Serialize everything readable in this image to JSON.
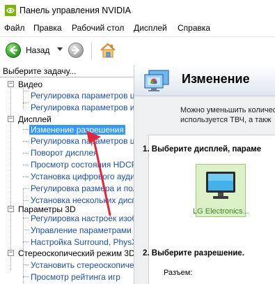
{
  "window": {
    "title": "Панель управления NVIDIA"
  },
  "menu": [
    "Файл",
    "Правка",
    "Рабочий стол",
    "Дисплей",
    "Справка"
  ],
  "toolbar": {
    "back_label": "Назад"
  },
  "left_pane": {
    "header": "Выберите задачу...",
    "tree": [
      {
        "label": "Видео",
        "expander": "−",
        "children": [
          "Регулировка параметров це",
          "Регулировка параметров из"
        ]
      },
      {
        "label": "Дисплей",
        "expander": "−",
        "children": [
          "Изменение разрешения",
          "Регулировка параметров це",
          "Поворот дисплея",
          "Просмотр состояния HDCP",
          "Установка цифрового аудио",
          "Регулировка размера и поло",
          "Установка нескольких дисп"
        ]
      },
      {
        "label": "Параметры 3D",
        "expander": "−",
        "children": [
          "Регулировка настроек изоб",
          "Управление параметрами 3D",
          "Настройка Surround, PhysX"
        ]
      },
      {
        "label": "Стереоскопический режим 3D",
        "expander": "−",
        "children": [
          "Установить стереоскопичес",
          "Просмотр рейтинга игр"
        ]
      }
    ],
    "selected": "Изменение разрешения"
  },
  "right_pane": {
    "banner_title": "Изменение",
    "desc_line1": "Можно уменьшить количес",
    "desc_line2": "используется ТВЧ, а такж",
    "step1": "1. Выберите дисплей, параме",
    "display_name": "LG Electronics...",
    "step2": "2. Выберите разрешение.",
    "connector_label": "Разъем:"
  },
  "colors": {
    "selection": "#3399ff",
    "link": "#1a4fb5",
    "annotation": "#e0283a",
    "display_tile": "#ddf1c9"
  }
}
